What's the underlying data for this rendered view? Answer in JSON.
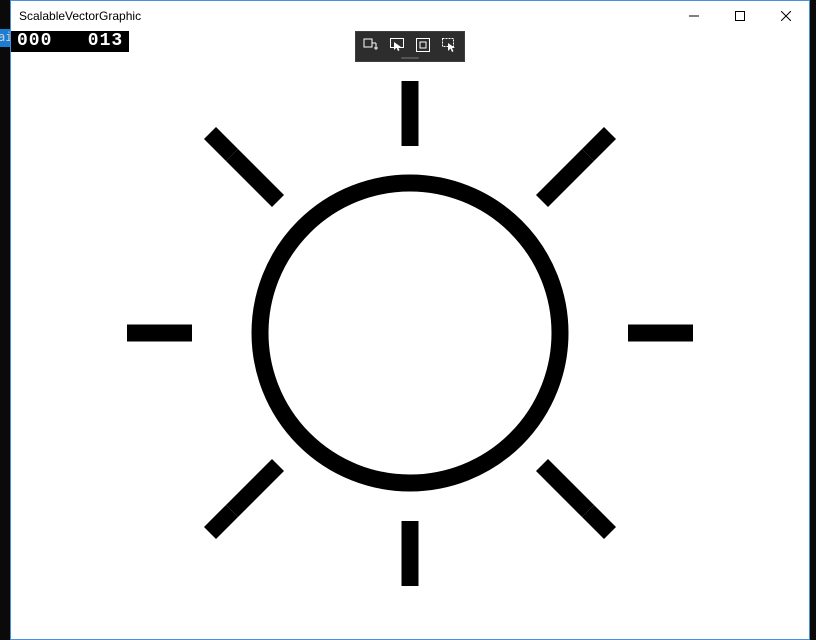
{
  "window": {
    "title": "ScalableVectorGraphic"
  },
  "counter": {
    "value": "000   013"
  },
  "behind": {
    "left_text": "ai"
  }
}
